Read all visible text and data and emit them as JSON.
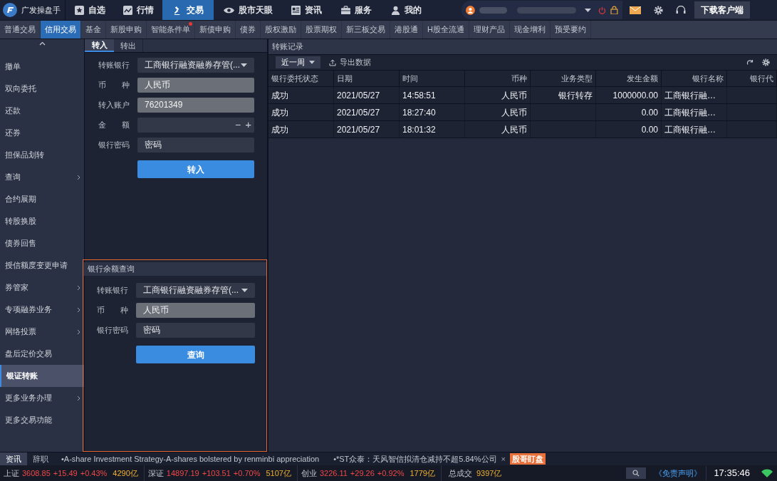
{
  "app": {
    "title": "广发操盘手"
  },
  "nav": [
    {
      "label": "自选",
      "selected": false
    },
    {
      "label": "行情",
      "selected": false
    },
    {
      "label": "交易",
      "selected": true
    },
    {
      "label": "股市天眼",
      "selected": false
    },
    {
      "label": "资讯",
      "selected": false
    },
    {
      "label": "服务",
      "selected": false
    },
    {
      "label": "我的",
      "selected": false
    }
  ],
  "download_button": "下载客户端",
  "subtabs": [
    {
      "label": "普通交易",
      "selected": false,
      "badge": false
    },
    {
      "label": "信用交易",
      "selected": true,
      "badge": false
    },
    {
      "label": "基金",
      "selected": false,
      "badge": false
    },
    {
      "label": "新股申购",
      "selected": false,
      "badge": false
    },
    {
      "label": "智能条件单",
      "selected": false,
      "badge": true
    },
    {
      "label": "新债申购",
      "selected": false,
      "badge": false
    },
    {
      "label": "债券",
      "selected": false,
      "badge": false
    },
    {
      "label": "股权激励",
      "selected": false,
      "badge": false
    },
    {
      "label": "股票期权",
      "selected": false,
      "badge": false
    },
    {
      "label": "新三板交易",
      "selected": false,
      "badge": false
    },
    {
      "label": "港股通",
      "selected": false,
      "badge": false
    },
    {
      "label": "H股全流通",
      "selected": false,
      "badge": false
    },
    {
      "label": "理财产品",
      "selected": false,
      "badge": false
    },
    {
      "label": "现金增利",
      "selected": false,
      "badge": false
    },
    {
      "label": "预受要约",
      "selected": false,
      "badge": false
    }
  ],
  "sidebar": [
    {
      "label": "撤单",
      "selected": false,
      "submenu": false
    },
    {
      "label": "双向委托",
      "selected": false,
      "submenu": false
    },
    {
      "label": "还款",
      "selected": false,
      "submenu": false
    },
    {
      "label": "还券",
      "selected": false,
      "submenu": false
    },
    {
      "label": "担保品划转",
      "selected": false,
      "submenu": false
    },
    {
      "label": "查询",
      "selected": false,
      "submenu": true
    },
    {
      "label": "合约展期",
      "selected": false,
      "submenu": false
    },
    {
      "label": "转股换股",
      "selected": false,
      "submenu": false
    },
    {
      "label": "债券回售",
      "selected": false,
      "submenu": false
    },
    {
      "label": "授信额度变更申请",
      "selected": false,
      "submenu": false
    },
    {
      "label": "券管家",
      "selected": false,
      "submenu": true
    },
    {
      "label": "专项融券业务",
      "selected": false,
      "submenu": true
    },
    {
      "label": "网络投票",
      "selected": false,
      "submenu": true
    },
    {
      "label": "盘后定价交易",
      "selected": false,
      "submenu": false
    },
    {
      "label": "银证转账",
      "selected": true,
      "submenu": false
    },
    {
      "label": "更多业务办理",
      "selected": false,
      "submenu": true
    },
    {
      "label": "更多交易功能",
      "selected": false,
      "submenu": false
    }
  ],
  "transfer_tabs": [
    {
      "label": "转入",
      "selected": true
    },
    {
      "label": "转出",
      "selected": false
    }
  ],
  "transfer_form": {
    "fields": [
      {
        "kind": "select",
        "label": "转账银行",
        "value": "工商银行融资融券存管(..."
      },
      {
        "kind": "readonly",
        "label": "币　　种",
        "value": "人民币"
      },
      {
        "kind": "readonly",
        "label": "转入账户",
        "value": "76201349"
      },
      {
        "kind": "stepper",
        "label": "金　　额",
        "minus": "−",
        "plus": "+"
      },
      {
        "kind": "password",
        "label": "银行密码",
        "placeholder": "密码"
      }
    ],
    "submit": "转入"
  },
  "balance_query": {
    "title": "银行余额查询",
    "fields": [
      {
        "kind": "select",
        "label": "转账银行",
        "value": "工商银行融资融券存管(..."
      },
      {
        "kind": "readonly",
        "label": "币　　种",
        "value": "人民币"
      },
      {
        "kind": "password",
        "label": "银行密码",
        "placeholder": "密码"
      }
    ],
    "submit": "查询"
  },
  "records": {
    "title": "转账记录",
    "period": "近一周",
    "export": "导出数据",
    "columns": [
      "银行委托状态",
      "日期",
      "时间",
      "币种",
      "业务类型",
      "发生金额",
      "银行名称",
      "银行代"
    ],
    "rows": [
      [
        "成功",
        "2021/05/27",
        "14:58:51",
        "人民币",
        "银行转存",
        "1000000.00",
        "工商银行融…",
        ""
      ],
      [
        "成功",
        "2021/05/27",
        "18:27:40",
        "人民币",
        "",
        "0.00",
        "工商银行融…",
        ""
      ],
      [
        "成功",
        "2021/05/27",
        "18:01:32",
        "人民币",
        "",
        "0.00",
        "工商银行融…",
        ""
      ]
    ]
  },
  "ticker": {
    "tabs": [
      {
        "label": "资讯",
        "selected": true
      },
      {
        "label": "辞职",
        "selected": false
      }
    ],
    "items": [
      "•A-share Investment Strategy-A-shares bolstered by renminbi appreciation",
      "•*ST众泰：天风智信拟清仓减持不超5.84%公司"
    ],
    "close": "×",
    "badge": "股哥盯盘"
  },
  "indices": [
    {
      "name": "上证",
      "value": "3608.85",
      "change": "+15.49",
      "pct": "+0.43%",
      "volume": "4290亿"
    },
    {
      "name": "深证",
      "value": "14897.19",
      "change": "+103.51",
      "pct": "+0.70%",
      "volume": "5107亿"
    },
    {
      "name": "创业",
      "value": "3226.11",
      "change": "+29.26",
      "pct": "+0.92%",
      "volume": "1779亿"
    }
  ],
  "total": {
    "label": "总成交",
    "value": "9397亿"
  },
  "disclaimer": "《免责声明》",
  "clock": "17:35:46"
}
